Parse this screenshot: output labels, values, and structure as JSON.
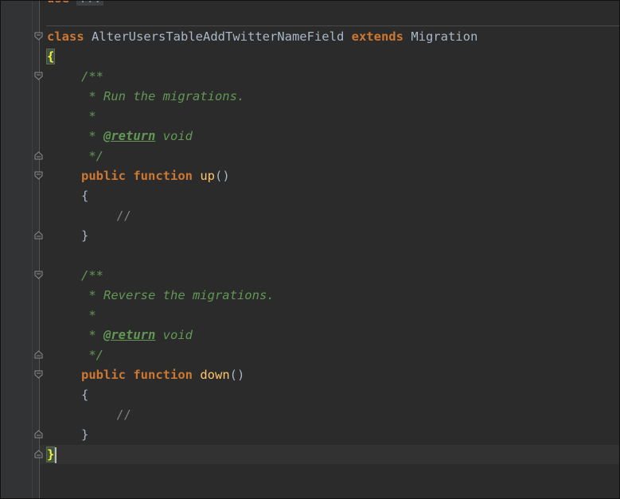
{
  "editor": {
    "top_use_keyword": "use",
    "top_fold_placeholder": "...",
    "lines": {
      "class_kw": "class",
      "class_name": "AlterUsersTableAddTwitterNameField",
      "extends_kw": "extends",
      "parent_class": "Migration",
      "open_brace": "{",
      "doc1_open": "/**",
      "doc1_text": " * Run the migrations.",
      "doc1_blank": " *",
      "doc1_return_prefix": " * ",
      "doc1_return_tag": "@return",
      "doc1_return_type": " void",
      "doc1_close": " */",
      "up_public": "public",
      "up_function": "function",
      "up_name": "up",
      "up_parens": "()",
      "up_open": "{",
      "up_comment": "//",
      "up_close": "}",
      "doc2_open": "/**",
      "doc2_text": " * Reverse the migrations.",
      "doc2_blank": " *",
      "doc2_return_prefix": " * ",
      "doc2_return_tag": "@return",
      "doc2_return_type": " void",
      "doc2_close": " */",
      "down_public": "public",
      "down_function": "function",
      "down_name": "down",
      "down_parens": "()",
      "down_open": "{",
      "down_comment": "//",
      "down_close": "}",
      "close_brace": "}"
    }
  },
  "colors": {
    "background": "#2b2b2b",
    "keyword": "#cc7832",
    "function_name": "#ffc66d",
    "doc_comment": "#629755",
    "text": "#a9b7c6",
    "brace_highlight": "#3b514d"
  }
}
